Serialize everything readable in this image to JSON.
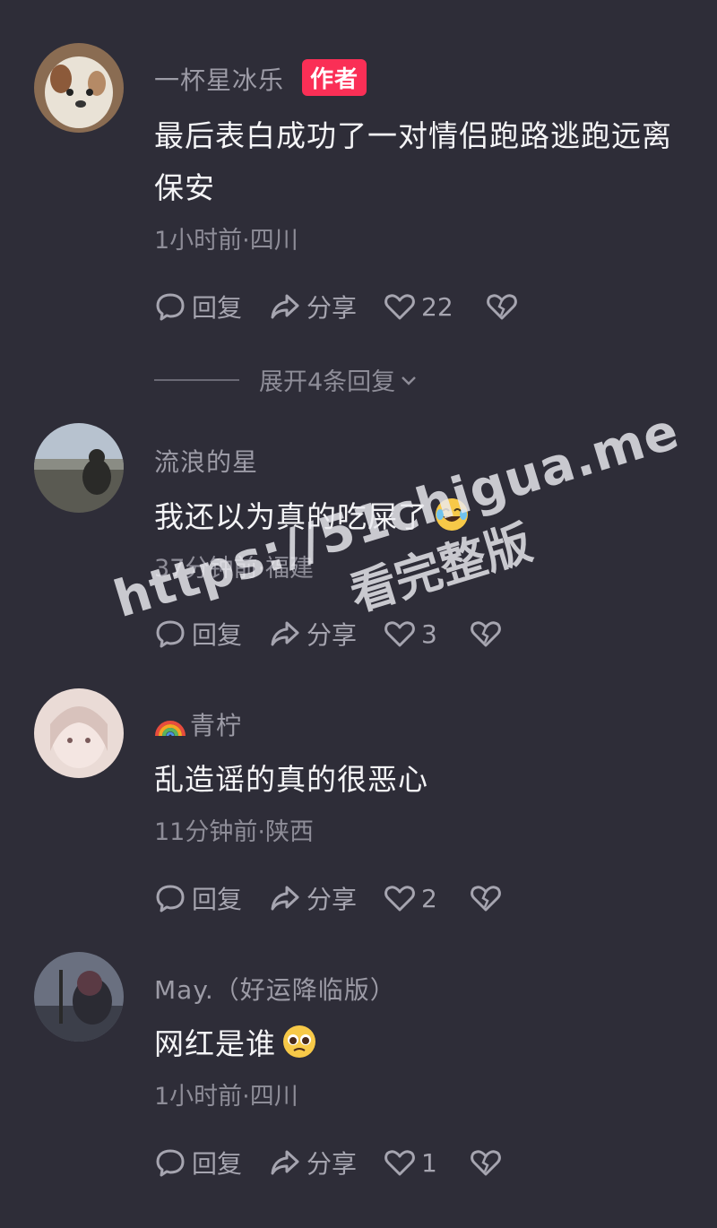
{
  "comments": [
    {
      "username": "一杯星冰乐",
      "badge": "作者",
      "text": "最后表白成功了一对情侣跑路逃跑远离保安",
      "meta": "1小时前·四川",
      "reply_label": "回复",
      "share_label": "分享",
      "likes": "22",
      "expand_label": "展开4条回复"
    },
    {
      "username": "流浪的星",
      "text": "我还以为真的吃屎了",
      "emoji": "laughing-tears-emoji",
      "meta": "37分钟前·福建",
      "reply_label": "回复",
      "share_label": "分享",
      "likes": "3"
    },
    {
      "username": "青柠",
      "username_prefix_icon": "rainbow-icon",
      "text": "乱造谣的真的很恶心",
      "meta": "11分钟前·陕西",
      "reply_label": "回复",
      "share_label": "分享",
      "likes": "2"
    },
    {
      "username": "May.（好运降临版）",
      "text": "网红是谁",
      "emoji": "pleading-face-emoji",
      "meta": "1小时前·四川",
      "reply_label": "回复",
      "share_label": "分享",
      "likes": "1"
    }
  ],
  "watermark": {
    "url": "https://51chigua.me",
    "subtitle": "看完整版"
  },
  "colors": {
    "background": "#2e2d38",
    "author_badge": "#fa2f56",
    "secondary_text": "#9c9ba6"
  }
}
